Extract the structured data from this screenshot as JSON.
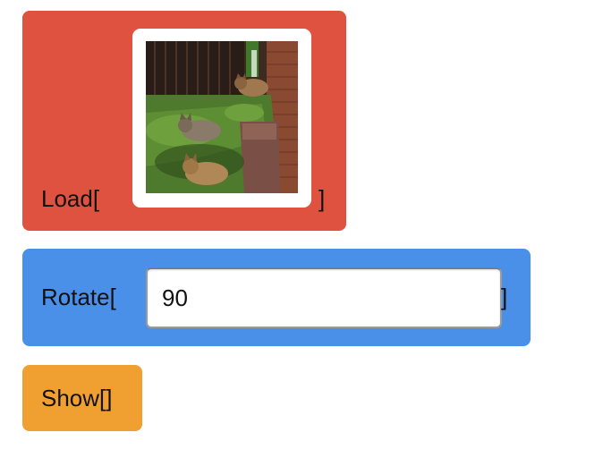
{
  "colors": {
    "load_block": "#e05240",
    "rotate_block": "#4a90e8",
    "show_block": "#f0a030"
  },
  "load": {
    "label": "Load[",
    "close": "]",
    "thumbnail_icon": "image-thumbnail"
  },
  "rotate": {
    "label": "Rotate[",
    "value": "90",
    "close": "]"
  },
  "show": {
    "label": "Show[]"
  }
}
